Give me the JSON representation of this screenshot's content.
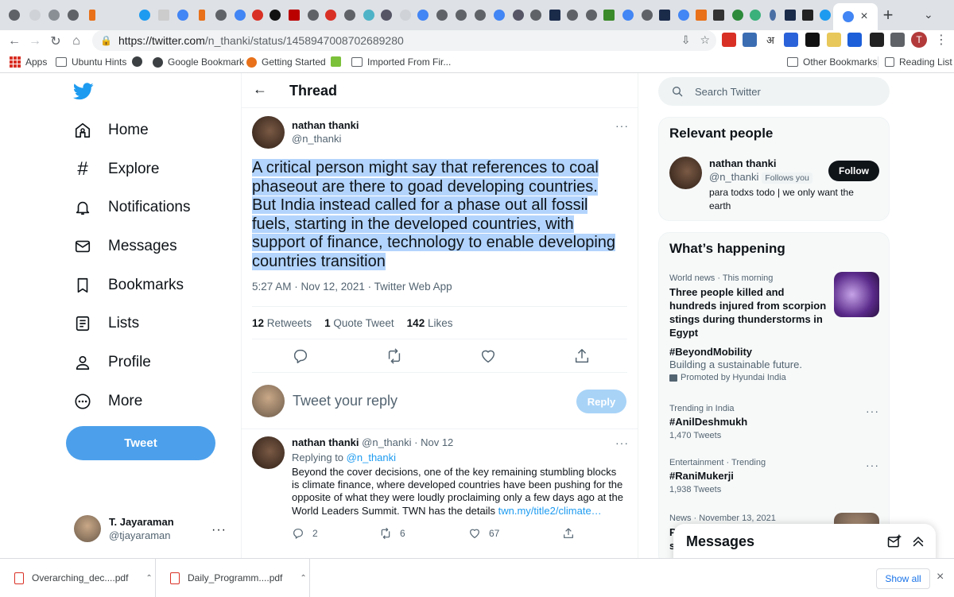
{
  "browser": {
    "url_host": "https://twitter.com",
    "url_path": "/n_thanki/status/1458947008702689280",
    "new_tab": "+",
    "tab_close": "×",
    "tab_menu": "⌄",
    "bookmarks": [
      {
        "label": "Apps",
        "icon": "apps-grid-icon"
      },
      {
        "label": "Ubuntu Hints",
        "icon": "folder-icon"
      },
      {
        "label": "",
        "icon": "globe-icon"
      },
      {
        "label": "Google Bookmark",
        "icon": "globe-icon"
      },
      {
        "label": "Getting Started",
        "icon": "firefox-icon"
      },
      {
        "label": "",
        "icon": "green-ext-icon"
      },
      {
        "label": "Imported From Fir...",
        "icon": "folder-icon"
      }
    ],
    "other_bookmarks": "Other Bookmarks",
    "reading_list": "Reading List",
    "profile_initial": "T"
  },
  "nav": {
    "items": [
      {
        "label": "Home",
        "icon": "home-icon"
      },
      {
        "label": "Explore",
        "icon": "hashtag-icon"
      },
      {
        "label": "Notifications",
        "icon": "bell-icon"
      },
      {
        "label": "Messages",
        "icon": "envelope-icon"
      },
      {
        "label": "Bookmarks",
        "icon": "bookmark-icon"
      },
      {
        "label": "Lists",
        "icon": "list-icon"
      },
      {
        "label": "Profile",
        "icon": "person-icon"
      },
      {
        "label": "More",
        "icon": "more-circle-icon"
      }
    ],
    "tweet_button": "Tweet",
    "account": {
      "name": "T. Jayaraman",
      "handle": "@tjayaraman",
      "more": "···"
    }
  },
  "thread": {
    "title": "Thread",
    "back": "←",
    "main": {
      "name": "nathan thanki",
      "handle": "@n_thanki",
      "more": "···",
      "text": "A critical person might say that references to coal phaseout are there to goad developing countries. But India instead called for a phase out all fossil fuels, starting in the developed countries, with support of finance, technology to enable developing countries transition",
      "meta": "5:27 AM · Nov 12, 2021 · Twitter Web App",
      "retweets": "12",
      "retweets_label": "Retweets",
      "quotes": "1",
      "quotes_label": "Quote Tweet",
      "likes": "142",
      "likes_label": "Likes"
    },
    "reply_placeholder": "Tweet your reply",
    "reply_button": "Reply",
    "reply_tweet": {
      "name": "nathan thanki",
      "handle": "@n_thanki",
      "sep": "·",
      "date": "Nov 12",
      "more": "···",
      "replying_to": "Replying to",
      "replying_handle": "@n_thanki",
      "text": "Beyond the cover decisions, one of the key remaining stumbling blocks is climate finance, where developed countries have been pushing for the opposite of what they were loudly proclaiming only a few days ago at the World Leaders Summit. TWN has the details",
      "link": "twn.my/title2/climate…",
      "replies": "2",
      "retweets": "6",
      "likes": "67"
    }
  },
  "sidebar": {
    "search_placeholder": "Search Twitter",
    "relevant": {
      "title": "Relevant people",
      "name": "nathan thanki",
      "handle": "@n_thanki",
      "follows_you": "Follows you",
      "bio": "para todxs todo | we only want the earth",
      "follow": "Follow"
    },
    "happening": {
      "title": "What’s happening",
      "trends": [
        {
          "ctx": "World news · This morning",
          "headline": "Three people killed and hundreds injured from scorpion stings during thunderstorms in Egypt"
        },
        {
          "headline": "#BeyondMobility",
          "sub": "Building a sustainable future.",
          "promoted": "Promoted by Hyundai India"
        },
        {
          "ctx": "Trending in India",
          "headline": "#AnilDeshmukh",
          "count": "1,470 Tweets",
          "more": "···"
        },
        {
          "ctx": "Entertainment · Trending",
          "headline": "#RaniMukerji",
          "count": "1,938 Tweets",
          "more": "···"
        },
        {
          "ctx": "News · November 13, 2021",
          "headline": "P",
          "headline2": "sa"
        }
      ]
    },
    "messages_drawer": "Messages"
  },
  "downloads": {
    "items": [
      "Overarching_dec....pdf",
      "Daily_Programm....pdf"
    ],
    "show_all": "Show all",
    "close": "×"
  },
  "colors": {
    "brand": "#1d9bf0",
    "tweet_button": "#4ca0eb",
    "selection": "#b3d4fc"
  }
}
